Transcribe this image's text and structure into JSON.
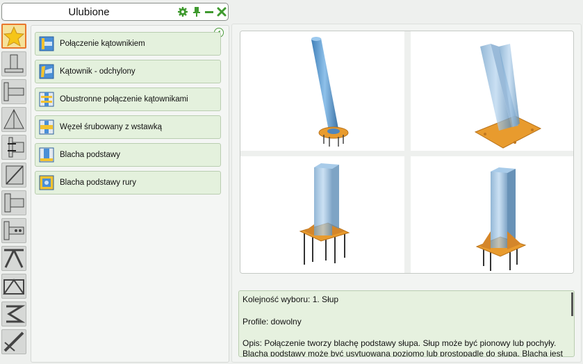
{
  "window": {
    "title": "Ulubione"
  },
  "toolbar_icons": [
    "gear-icon",
    "pin-icon",
    "minimize-icon",
    "close-icon"
  ],
  "categories": [
    {
      "name": "favorites",
      "icon": "star-icon",
      "active": true
    },
    {
      "name": "base-plates",
      "icon": "base-plate-icon"
    },
    {
      "name": "beam-column",
      "icon": "beam-column-icon"
    },
    {
      "name": "bracing",
      "icon": "bracing-icon"
    },
    {
      "name": "beam-splice",
      "icon": "splice-icon"
    },
    {
      "name": "gusset",
      "icon": "gusset-icon"
    },
    {
      "name": "end-plates",
      "icon": "end-plate-icon"
    },
    {
      "name": "cleats",
      "icon": "cleat-icon"
    },
    {
      "name": "truss-nodes",
      "icon": "truss-node-icon"
    },
    {
      "name": "trusses",
      "icon": "truss-icon"
    },
    {
      "name": "purlins",
      "icon": "purlin-icon"
    },
    {
      "name": "misc",
      "icon": "misc-icon"
    }
  ],
  "items": [
    {
      "label": "Połączenie kątownikiem",
      "icon": "angle-connection-icon"
    },
    {
      "label": "Kątownik - odchylony",
      "icon": "angle-skewed-icon"
    },
    {
      "label": "Obustronne połączenie kątownikami",
      "icon": "double-angle-icon"
    },
    {
      "label": "Węzeł śrubowany z wstawką",
      "icon": "bolted-insert-icon"
    },
    {
      "label": "Blacha podstawy",
      "icon": "base-plate-icon"
    },
    {
      "label": "Blacha podstawy rury",
      "icon": "tube-base-plate-icon"
    }
  ],
  "description": {
    "line1": "Kolejność wyboru: 1. Słup",
    "line2": "Profile: dowolny",
    "line3": "Opis: Połączenie tworzy blachę podstawy słupa. Słup może być pionowy lub pochyły.",
    "line4": "Blacha podstawy może być usytuowana poziomo lub prostopadle do słupa. Blacha jest"
  },
  "colors": {
    "accent_green": "#3f9a2f",
    "item_bg": "#e4f1dd",
    "active_border": "#e8772d",
    "steel_blue": "#5f9fd3",
    "plate_orange": "#e89b2e"
  }
}
